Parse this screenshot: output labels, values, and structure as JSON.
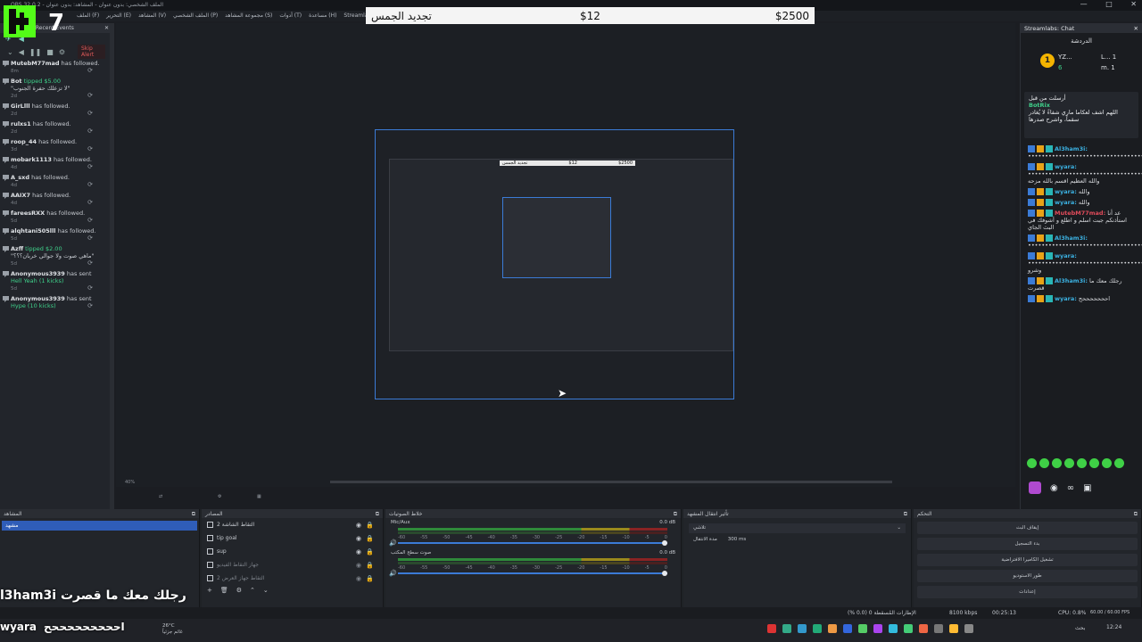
{
  "window": {
    "title": "OBS 32.0.2 - الملف الشخصي: بدون عنوان - المشاهد: بدون عنوان",
    "controls": [
      "—",
      "□",
      "✕"
    ]
  },
  "menu": [
    "Streamlabs",
    "مساعدة (H)",
    "أدوات (T)",
    "مجموعة المشاهد (S)",
    "الملف الشخصي (P)",
    "المشاهد (V)",
    "التحرير (E)",
    "الملف (F)"
  ],
  "banner": {
    "left": "تجديد الجمس",
    "mid": "$12",
    "right": "$2500"
  },
  "logo": {
    "letter": "K",
    "number": "7"
  },
  "recent_events": {
    "title": "Streamlabs Recent Events",
    "skip_label": "Skip Alert",
    "events": [
      {
        "user": "MutebM77mad",
        "action": "has followed.",
        "time": "8m"
      },
      {
        "user": "Bot",
        "action": "tipped $5.00",
        "note": "\"لا تزعلك حفرة الجنوب\"",
        "time": "2d"
      },
      {
        "user": "GirLlll",
        "action": "has followed.",
        "time": "2d"
      },
      {
        "user": "rulxs1",
        "action": "has followed.",
        "time": "2d"
      },
      {
        "user": "roop_44",
        "action": "has followed.",
        "time": "3d"
      },
      {
        "user": "mobark1113",
        "action": "has followed.",
        "time": "4d"
      },
      {
        "user": "A_sxd",
        "action": "has followed.",
        "time": "4d"
      },
      {
        "user": "AAIX7",
        "action": "has followed.",
        "time": "4d"
      },
      {
        "user": "fareesRXX",
        "action": "has followed.",
        "time": "5d"
      },
      {
        "user": "alqhtani505lll",
        "action": "has followed.",
        "time": "5d"
      },
      {
        "user": "Azff",
        "action": "tipped $2.00",
        "note": "\"ماهي صوت ولا جوالي خربان؟؟؟\"",
        "time": "5d"
      },
      {
        "user": "Anonymous3939",
        "action": "has sent",
        "extra": "Hell Yeah (1 kicks)",
        "time": "5d"
      },
      {
        "user": "Anonymous3939",
        "action": "has sent",
        "extra": "Hype (10 kicks)",
        "time": ""
      }
    ]
  },
  "preview": {
    "mini_banner": {
      "left": "تجديد الجمس",
      "mid": "$12",
      "right": "$2500"
    },
    "zoom": "40%"
  },
  "chat": {
    "title": "Streamlabs: Chat",
    "tab": "الدردشة",
    "leaderboard": {
      "top_name": "YZ...",
      "top_count": "6",
      "second": "L... 1",
      "third": "m. 1",
      "rank": "1"
    },
    "pinned": {
      "header": "أرسلت من قبل",
      "user": "BotRix",
      "text": "اللهم اشف لعكاما ماري شفاءً لا يُغادر سقماً، واشرح صدرها"
    },
    "messages": [
      {
        "user": "Al3ham3i:",
        "text": "••••••••••••••••••••••••••••••••••••••••••••••"
      },
      {
        "user": "wyara:",
        "text": "•••••••••••••••••••••••••••••••••••••••• والله العظيم اقسم بالله مزحه"
      },
      {
        "user": "wyara:",
        "text": "والله"
      },
      {
        "user": "wyara:",
        "text": "والله"
      },
      {
        "user": "MutebM77mad:",
        "text": "عد أنا استأذنكم جبت اسلم و اطلع و أشوفك في البث الجاي",
        "red": true
      },
      {
        "user": "Al3ham3i:",
        "text": "••••••••••••••••••••••••••••••••••"
      },
      {
        "user": "wyara:",
        "text": "••••••••••••••••••••••••••••••••••• وشرو"
      },
      {
        "user": "Al3ham3i:",
        "text": "رجلك معك ما قصرت"
      },
      {
        "user": "wyara:",
        "text": "احححححححح"
      }
    ]
  },
  "docks": {
    "scenes": {
      "title": "المشاهد",
      "selected": "مشهد"
    },
    "sources": {
      "title": "المصادر",
      "items": [
        {
          "label": "التقاط الشاشة 2",
          "dim": false
        },
        {
          "label": "tip goal",
          "dim": false
        },
        {
          "label": "sup",
          "dim": false
        },
        {
          "label": "جهاز التقاط الفيديو",
          "dim": true
        },
        {
          "label": "التقاط جهاز العرض 2",
          "dim": true
        }
      ]
    },
    "mixer": {
      "title": "خلاط الصوتيات",
      "channels": [
        {
          "name": "Mic/Aux",
          "db": "0.0 dB",
          "level": 0.9
        },
        {
          "name": "صوت سطح المكتب",
          "db": "0.0 dB",
          "level": 0.8
        }
      ],
      "ticks": [
        "-60",
        "-55",
        "-50",
        "-45",
        "-40",
        "-35",
        "-30",
        "-25",
        "-20",
        "-15",
        "-10",
        "-5",
        "0"
      ]
    },
    "transitions": {
      "title": "تأثير انتقال المشهد",
      "selected": "تلاشي",
      "duration_label": "مدة الانتقال",
      "duration": "300 ms"
    },
    "controls": {
      "title": "التحكم",
      "buttons": [
        "إيقاف البث",
        "بدء التسجيل",
        "تشغيل الكاميرا الافتراضية",
        "طور الاستوديو",
        "إعدادات"
      ]
    }
  },
  "status": {
    "frames": "الإطارات المُسقطة 0 (0.0 %)",
    "bitrate": "8100 kbps",
    "time": "00:25:13",
    "cpu": "CPU: 0.8%",
    "fps": "60.00 / 60.00 FPS"
  },
  "overlay": {
    "name_line": "l3ham3i رجلك معك ما قصرت",
    "wyara_name": "wyara",
    "wyara_text": "احححححححححح"
  },
  "taskbar": {
    "weather_temp": "26°C",
    "weather_desc": "غائم جزئياً",
    "search": "بحث",
    "clock": "12:24"
  },
  "colors": {
    "accent": "#3b7bd6",
    "green": "#3fd08a",
    "danger": "#e05a5a",
    "kick_green": "#53fc18"
  }
}
